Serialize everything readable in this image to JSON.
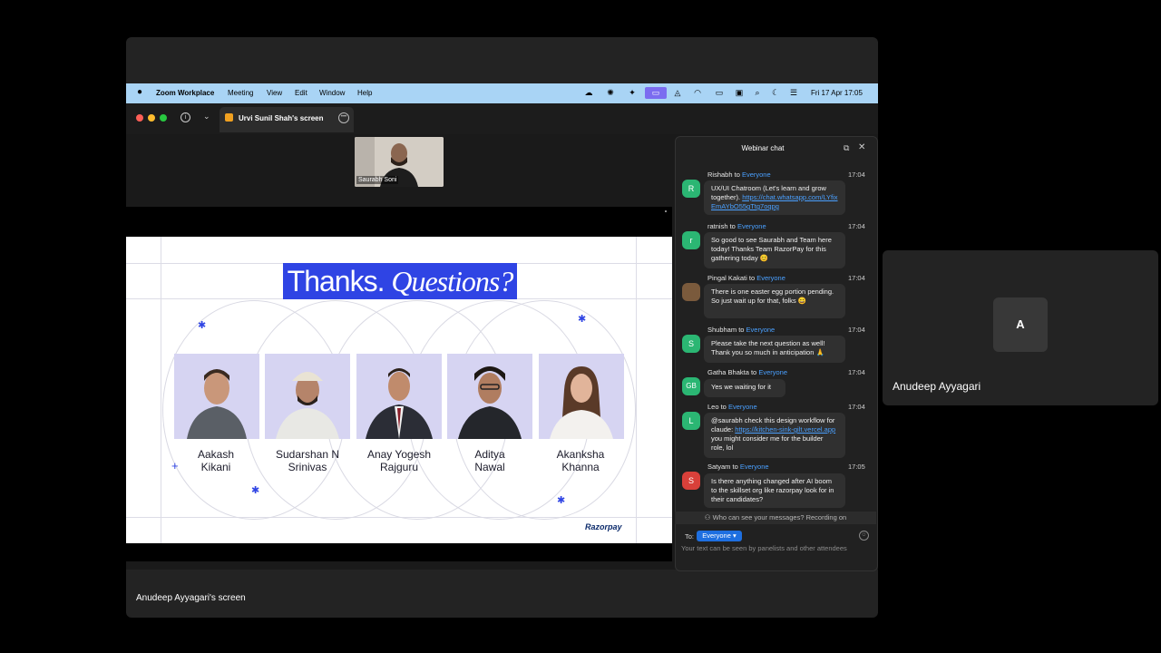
{
  "menubar": {
    "app_name": "Zoom Workplace",
    "items": [
      "Meeting",
      "View",
      "Edit",
      "Window",
      "Help"
    ],
    "clock": "Fri 17 Apr  17:05"
  },
  "window": {
    "share_tab_label": "Urvi Sunil Shah's screen",
    "speaker_name": "Saurabh Soni"
  },
  "slide": {
    "title_plain": "Thanks.",
    "title_italic": "Questions?",
    "people": [
      {
        "first": "Aakash",
        "last": "Kikani"
      },
      {
        "first": "Sudarshan N",
        "last": "Srinivas"
      },
      {
        "first": "Anay Yogesh",
        "last": "Rajguru"
      },
      {
        "first": "Aditya",
        "last": "Nawal"
      },
      {
        "first": "Akanksha",
        "last": "Khanna"
      }
    ],
    "brand": "Razorpay"
  },
  "chat": {
    "title": "Webinar chat",
    "messages": [
      {
        "sender": "Rishabh",
        "to": "Everyone",
        "time": "17:04",
        "avatar": "R",
        "color": "#2bb673",
        "text": "UX/UI Chatroom (Let's learn and grow together). ",
        "link": "https://chat.whatsapp.com/LYfixEmAYbO55gTtg7oqpg"
      },
      {
        "sender": "ratnish",
        "to": "Everyone",
        "time": "17:04",
        "avatar": "r",
        "color": "#2bb673",
        "text": "So good to see Saurabh and Team here today! Thanks Team RazorPay for this gathering today 😊"
      },
      {
        "sender": "Pingal Kakati",
        "to": "Everyone",
        "time": "17:04",
        "avatar": "",
        "color": "#7a5a3c",
        "text": "There is one easter egg portion pending. So just wait up for that, folks 😄"
      },
      {
        "sender": "Shubham",
        "to": "Everyone",
        "time": "17:04",
        "avatar": "S",
        "color": "#2bb673",
        "text": "Please take the next question as well! Thank you so much in anticipation 🙏"
      },
      {
        "sender": "Gatha Bhakta",
        "to": "Everyone",
        "time": "17:04",
        "avatar": "GB",
        "color": "#2bb673",
        "text": "Yes we waiting for it"
      },
      {
        "sender": "Leo",
        "to": "Everyone",
        "time": "17:04",
        "avatar": "L",
        "color": "#2bb673",
        "text": "@saurabh check this design workflow for claude: ",
        "link": "https://kitchen-sink-gilt.vercel.app",
        "text_after": " you might consider me for the builder role, lol"
      },
      {
        "sender": "Satyam",
        "to": "Everyone",
        "time": "17:05",
        "avatar": "S",
        "color": "#d9403a",
        "text": "Is there anything changed after AI boom to the skillset org like razorpay look for in their candidates?"
      }
    ],
    "privacy_notice": "Who can see your messages? Recording on",
    "to_label": "To:",
    "to_value": "Everyone",
    "input_placeholder": "Your text can be seen by panelists and other attendees"
  },
  "participant": {
    "initial": "A",
    "name": "Anudeep Ayyagari"
  },
  "footer": {
    "screen_label": "Anudeep Ayyagari's screen"
  },
  "colors": {
    "menubar_bg": "#a9d4f5",
    "slide_accent": "#2f44e4",
    "chat_link": "#4aa0ff"
  }
}
